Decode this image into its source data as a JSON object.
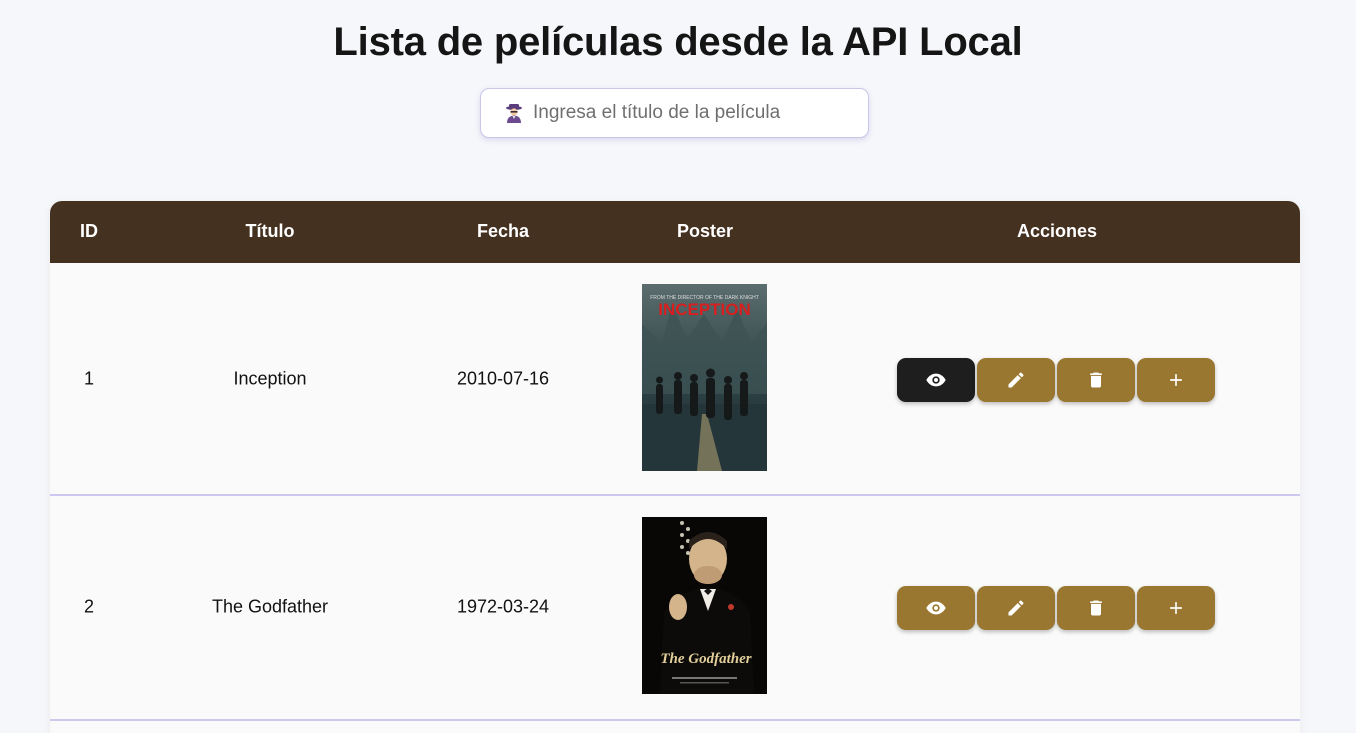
{
  "header": {
    "title": "Lista de películas desde la API Local"
  },
  "search": {
    "placeholder": "Ingresa el título de la película",
    "value": ""
  },
  "table": {
    "columns": [
      "ID",
      "Título",
      "Fecha",
      "Poster",
      "Acciones"
    ],
    "rows": [
      {
        "id": "1",
        "title": "Inception",
        "date": "2010-07-16",
        "poster": {
          "tagline": "FROM THE DIRECTOR OF THE DARK KNIGHT",
          "wordmark": "INCEPTION"
        },
        "active_action": "view"
      },
      {
        "id": "2",
        "title": "The Godfather",
        "date": "1972-03-24",
        "poster": {
          "tagline": "",
          "wordmark": "The Godfather"
        },
        "active_action": null
      }
    ]
  },
  "actions": [
    {
      "name": "view",
      "icon": "eye-icon"
    },
    {
      "name": "edit",
      "icon": "pencil-icon"
    },
    {
      "name": "delete",
      "icon": "trash-icon"
    },
    {
      "name": "add",
      "icon": "plus-icon"
    }
  ],
  "colors": {
    "header_bg": "#453120",
    "button": "#9a7730",
    "button_active": "#1e1e1e",
    "row_divider": "#cdc8ef",
    "page_bg": "#f6f7fa"
  }
}
